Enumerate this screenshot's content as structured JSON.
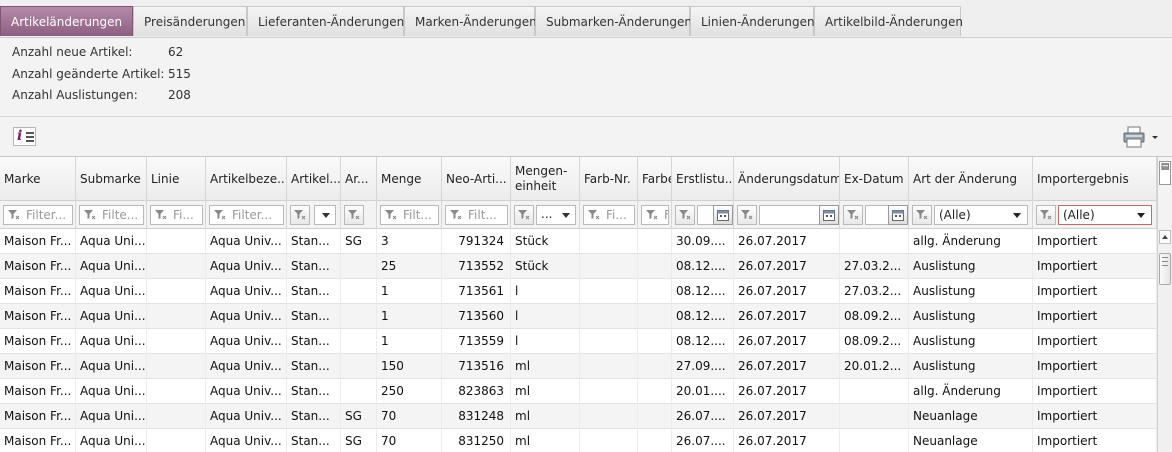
{
  "tabs": [
    {
      "label": "Artikeländerungen",
      "active": true
    },
    {
      "label": "Preisänderungen",
      "active": false
    },
    {
      "label": "Lieferanten-Änderungen",
      "active": false
    },
    {
      "label": "Marken-Änderungen",
      "active": false
    },
    {
      "label": "Submarken-Änderungen",
      "active": false
    },
    {
      "label": "Linien-Änderungen",
      "active": false
    },
    {
      "label": "Artikelbild-Änderungen",
      "active": false
    }
  ],
  "stats": [
    {
      "label": "Anzahl neue Artikel:",
      "value": "62"
    },
    {
      "label": "Anzahl geänderte Artikel:",
      "value": "515"
    },
    {
      "label": "Anzahl Auslistungen:",
      "value": "208"
    }
  ],
  "toolbar": {
    "info_icon": "info-list-icon",
    "print_icon": "printer-icon"
  },
  "columns": [
    "Marke",
    "Submarke",
    "Linie",
    "Artikelbeze...",
    "Artikel...",
    "Ar...",
    "Menge",
    "Neo-Arti...",
    "Mengen-\neinheit",
    "Farb-Nr.",
    "Farbe",
    "Erstlistu...",
    "Änderungsdatum",
    "Ex-Datum",
    "Art der Änderung",
    "Importergebnis"
  ],
  "filters": {
    "marke": "Filter...",
    "submarke": "Filte...",
    "linie": "Fi...",
    "artikelbez": "Filter...",
    "menge": "Filt...",
    "neoart": "Filt...",
    "mengeneinheit": "...",
    "farbnr": "Fi...",
    "farbe": "F",
    "art_der_aenderung": "(Alle)",
    "importergebnis": "(Alle)"
  },
  "rows": [
    [
      "Maison Fr...",
      "Aqua Uni...",
      "",
      "Aqua Univ...",
      "Stan...",
      "SG",
      "3",
      "791324",
      "Stück",
      "",
      "",
      "30.09....",
      "26.07.2017",
      "",
      "allg. Änderung",
      "Importiert"
    ],
    [
      "Maison Fr...",
      "Aqua Uni...",
      "",
      "Aqua Univ...",
      "Stan...",
      "",
      "25",
      "713552",
      "Stück",
      "",
      "",
      "08.12....",
      "26.07.2017",
      "27.03.2...",
      "Auslistung",
      "Importiert"
    ],
    [
      "Maison Fr...",
      "Aqua Uni...",
      "",
      "Aqua Univ...",
      "Stan...",
      "",
      "1",
      "713561",
      "l",
      "",
      "",
      "08.12....",
      "26.07.2017",
      "27.03.2...",
      "Auslistung",
      "Importiert"
    ],
    [
      "Maison Fr...",
      "Aqua Uni...",
      "",
      "Aqua Univ...",
      "Stan...",
      "",
      "1",
      "713560",
      "l",
      "",
      "",
      "08.12....",
      "26.07.2017",
      "08.09.2...",
      "Auslistung",
      "Importiert"
    ],
    [
      "Maison Fr...",
      "Aqua Uni...",
      "",
      "Aqua Univ...",
      "Stan...",
      "",
      "1",
      "713559",
      "l",
      "",
      "",
      "08.12....",
      "26.07.2017",
      "08.09.2...",
      "Auslistung",
      "Importiert"
    ],
    [
      "Maison Fr...",
      "Aqua Uni...",
      "",
      "Aqua Univ...",
      "Stan...",
      "",
      "150",
      "713516",
      "ml",
      "",
      "",
      "27.09....",
      "26.07.2017",
      "20.01.2...",
      "Auslistung",
      "Importiert"
    ],
    [
      "Maison Fr...",
      "Aqua Uni...",
      "",
      "Aqua Univ...",
      "Stan...",
      "",
      "250",
      "823863",
      "ml",
      "",
      "",
      "20.01....",
      "26.07.2017",
      "",
      "allg. Änderung",
      "Importiert"
    ],
    [
      "Maison Fr...",
      "Aqua Uni...",
      "",
      "Aqua Univ...",
      "Stan...",
      "SG",
      "70",
      "831248",
      "ml",
      "",
      "",
      "26.07....",
      "26.07.2017",
      "",
      "Neuanlage",
      "Importiert"
    ],
    [
      "Maison Fr...",
      "Aqua Uni...",
      "",
      "Aqua Univ...",
      "Stan...",
      "SG",
      "70",
      "831250",
      "ml",
      "",
      "",
      "26.07....",
      "26.07.2017",
      "",
      "Neuanlage",
      "Importiert"
    ]
  ],
  "colors": {
    "active_tab": "#8d5f81",
    "row_alt": "#f4f4f4"
  }
}
